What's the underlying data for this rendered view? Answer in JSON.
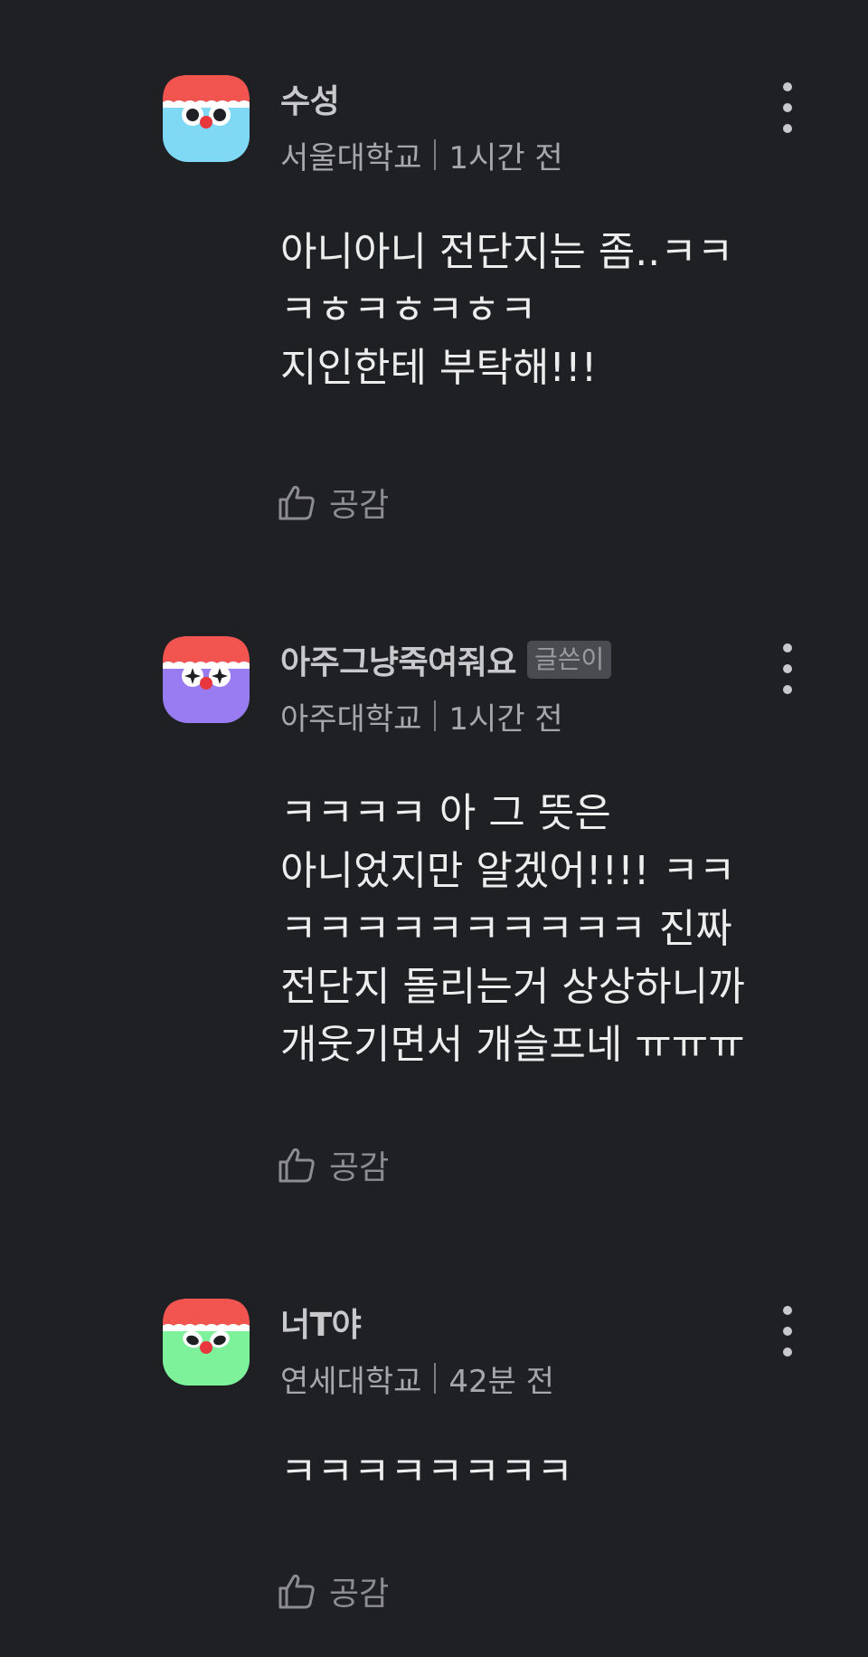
{
  "comments": [
    {
      "author": "수성",
      "badge": "",
      "school": "서울대학교",
      "time": "1시간 전",
      "body": "아니아니 전단지는 좀..ㅋㅋ\nㅋㅎㅋㅎㅋㅎㅋ\n지인한테 부탁해!!!",
      "like_label": "공감",
      "avatar_color": "#7fd9f5"
    },
    {
      "author": "아주그냥죽여줘요",
      "badge": "글쓴이",
      "school": "아주대학교",
      "time": "1시간 전",
      "body": "ㅋㅋㅋㅋ 아 그 뜻은\n아니었지만 알겠어!!!! ㅋㅋ\nㅋㅋㅋㅋㅋㅋㅋㅋㅋㅋ 진짜\n전단지 돌리는거 상상하니까\n개웃기면서 개슬프네 ㅠㅠㅠ",
      "like_label": "공감",
      "avatar_color": "#9a7cf2"
    },
    {
      "author": "너T야",
      "badge": "",
      "school": "연세대학교",
      "time": "42분 전",
      "body": "ㅋㅋㅋㅋㅋㅋㅋㅋ",
      "like_label": "공감",
      "avatar_color": "#7df29a"
    }
  ],
  "icons": {
    "avatar": "owl-avatar-icon",
    "more": "more-vertical-icon",
    "like": "thumbs-up-icon"
  }
}
